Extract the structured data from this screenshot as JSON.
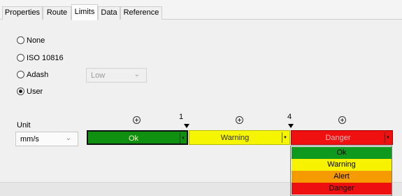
{
  "tabs": [
    {
      "label": "Properties"
    },
    {
      "label": "Route"
    },
    {
      "label": "Limits"
    },
    {
      "label": "Data"
    },
    {
      "label": "Reference"
    }
  ],
  "active_tab": "Limits",
  "limit_mode": {
    "options": [
      {
        "label": "None",
        "selected": false
      },
      {
        "label": "ISO 10816",
        "selected": false
      },
      {
        "label": "Adash",
        "selected": false
      },
      {
        "label": "User",
        "selected": true
      }
    ],
    "adash_level": {
      "value": "Low",
      "enabled": false
    }
  },
  "unit": {
    "label": "Unit",
    "value": "mm/s"
  },
  "thresholds": [
    "1",
    "4"
  ],
  "levels": [
    {
      "label": "Ok",
      "color": "#109010",
      "text_color": "#f2f2c8"
    },
    {
      "label": "Warning",
      "color": "#f5f500",
      "text_color": "#303030"
    },
    {
      "label": "Danger",
      "color": "#ef1010",
      "text_color": "#ffb4b4"
    }
  ],
  "danger_dropdown_options": [
    {
      "label": "Ok",
      "color": "#0f9a1f"
    },
    {
      "label": "Warning",
      "color": "#f7f200"
    },
    {
      "label": "Alert",
      "color": "#f59a00"
    },
    {
      "label": "Danger",
      "color": "#ee1010"
    }
  ]
}
